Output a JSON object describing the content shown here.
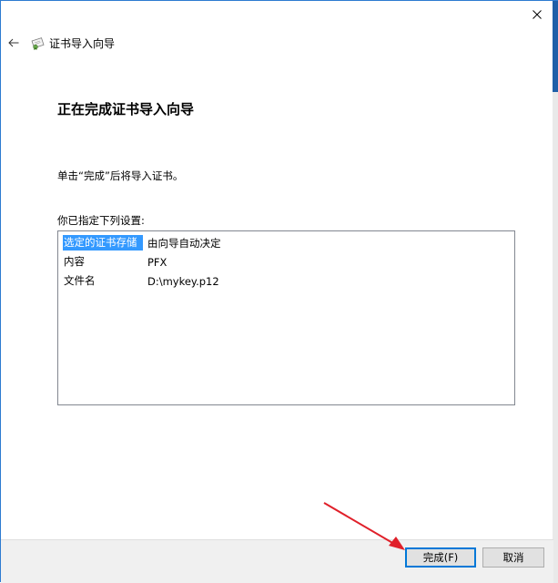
{
  "window": {
    "wizard_title": "证书导入向导"
  },
  "main": {
    "heading": "正在完成证书导入向导",
    "instruction": "单击“完成”后将导入证书。",
    "settings_label": "你已指定下列设置:",
    "settings": [
      {
        "key": "选定的证书存储",
        "value": "由向导自动决定",
        "selected": true
      },
      {
        "key": "内容",
        "value": "PFX",
        "selected": false
      },
      {
        "key": "文件名",
        "value": "D:\\mykey.p12",
        "selected": false
      }
    ]
  },
  "footer": {
    "finish_label": "完成(F)",
    "cancel_label": "取消"
  },
  "colors": {
    "selection": "#3399ff",
    "accent": "#0078d7",
    "annotation": "#e0202a"
  },
  "icons": {
    "close": "close-icon",
    "back": "back-arrow-icon",
    "certificate": "certificate-icon"
  }
}
